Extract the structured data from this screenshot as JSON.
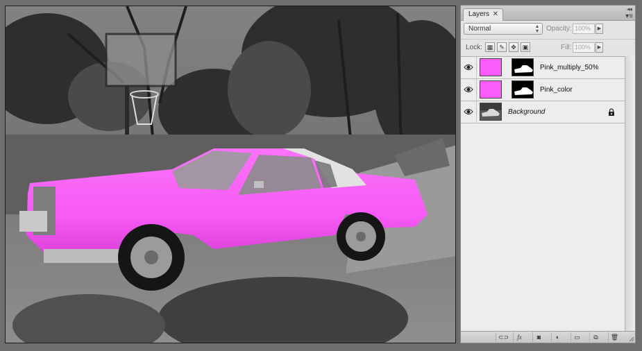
{
  "panel": {
    "tab_label": "Layers",
    "tab_close": "✕",
    "collapse_glyph": "◂◂",
    "menu_glyph": "▾≡"
  },
  "controls": {
    "blend_mode": "Normal",
    "opacity_label": "Opacity:",
    "opacity_value": "100%",
    "lock_label": "Lock:",
    "fill_label": "Fill:",
    "fill_value": "100%"
  },
  "layers": [
    {
      "name": "Pink_multiply_50%",
      "visible": true,
      "thumb_color": "#fa5cf9",
      "has_mask": true,
      "italic": false,
      "locked": false
    },
    {
      "name": "Pink_color",
      "visible": true,
      "thumb_color": "#fa5cf9",
      "has_mask": true,
      "italic": false,
      "locked": false
    },
    {
      "name": "Background",
      "visible": true,
      "thumb_color": "#777777",
      "has_mask": false,
      "italic": true,
      "locked": true
    }
  ],
  "footer_buttons": [
    {
      "name": "link-layers",
      "glyph": "⊂⊃"
    },
    {
      "name": "layer-style",
      "glyph": "fx"
    },
    {
      "name": "add-mask",
      "glyph": "◙"
    },
    {
      "name": "new-adjustment",
      "glyph": "◐"
    },
    {
      "name": "new-group",
      "glyph": "▭"
    },
    {
      "name": "new-layer",
      "glyph": "⧉"
    },
    {
      "name": "delete-layer",
      "glyph": "🗑"
    }
  ],
  "colors": {
    "car_pink": "#f95cf7",
    "roof_white": "#e4e4e4",
    "panel_bg": "#e4e4e4"
  }
}
